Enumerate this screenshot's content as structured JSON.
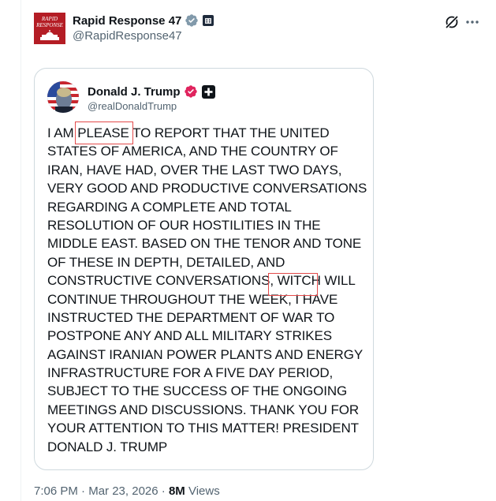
{
  "post": {
    "author_name": "Rapid Response 47",
    "author_handle": "@RapidResponse47",
    "avatar_text": "RAPID RESPONSE"
  },
  "quote": {
    "author_name": "Donald J. Trump",
    "author_handle": "@realDonaldTrump",
    "lines": [
      "I AM PLEASE TO REPORT THAT THE UNITED",
      "STATES OF AMERICA, AND THE COUNTRY OF",
      "IRAN, HAVE HAD, OVER THE LAST TWO DAYS,",
      "VERY GOOD AND PRODUCTIVE CONVERSATIONS",
      "REGARDING A COMPLETE AND TOTAL",
      "RESOLUTION OF OUR HOSTILITIES IN THE",
      "MIDDLE EAST. BASED ON THE TENOR AND TONE",
      "OF THESE IN DEPTH, DETAILED, AND",
      "CONSTRUCTIVE CONVERSATIONS, WITCH WILL",
      "CONTINUE THROUGHOUT THE WEEK, I HAVE",
      "INSTRUCTED THE DEPARTMENT OF WAR TO",
      "POSTPONE ANY AND ALL MILITARY STRIKES",
      "AGAINST IRANIAN POWER PLANTS AND ENERGY",
      "INFRASTRUCTURE FOR A FIVE DAY PERIOD,",
      "SUBJECT TO THE SUCCESS OF THE ONGOING",
      "MEETINGS AND DISCUSSIONS. THANK YOU FOR",
      "YOUR ATTENTION TO THIS MATTER! PRESIDENT",
      "DONALD J. TRUMP"
    ],
    "highlighted_words": [
      "PLEASE",
      "WITCH"
    ]
  },
  "meta": {
    "time": "7:06 PM",
    "separator": " · ",
    "date": "Mar 23, 2026",
    "views_count": "8M",
    "views_label": " Views"
  },
  "icons": {
    "verified": "verified-badge-icon",
    "affiliate": "affiliate-badge-icon",
    "grok": "grok-icon",
    "more": "more-icon"
  },
  "colors": {
    "verified_blue": "#1d9bf0",
    "verified_gold_red": "#e0245e",
    "highlight_red": "#e34a4a",
    "brand_red": "#b41d25"
  }
}
